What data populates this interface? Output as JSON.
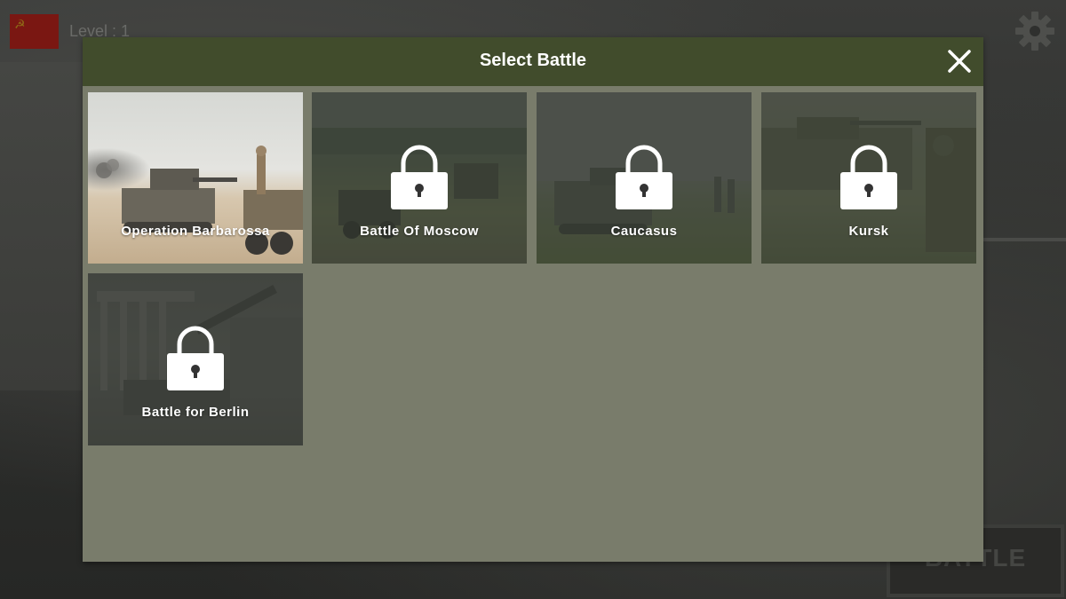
{
  "hud": {
    "level_text": "Level : 1",
    "battle_button_label": "BATTLE",
    "flag_icon": "soviet-flag-icon",
    "settings_icon": "gear-icon"
  },
  "modal": {
    "title": "Select Battle",
    "close_icon": "close-icon"
  },
  "battles": [
    {
      "name": "Operation Barbarossa",
      "locked": false
    },
    {
      "name": "Battle Of Moscow",
      "locked": true
    },
    {
      "name": "Caucasus",
      "locked": true
    },
    {
      "name": "Kursk",
      "locked": true
    },
    {
      "name": "Battle for Berlin",
      "locked": true
    }
  ],
  "colors": {
    "header": "#414c2c",
    "panel": "#797c6b",
    "text": "#ffffff"
  }
}
